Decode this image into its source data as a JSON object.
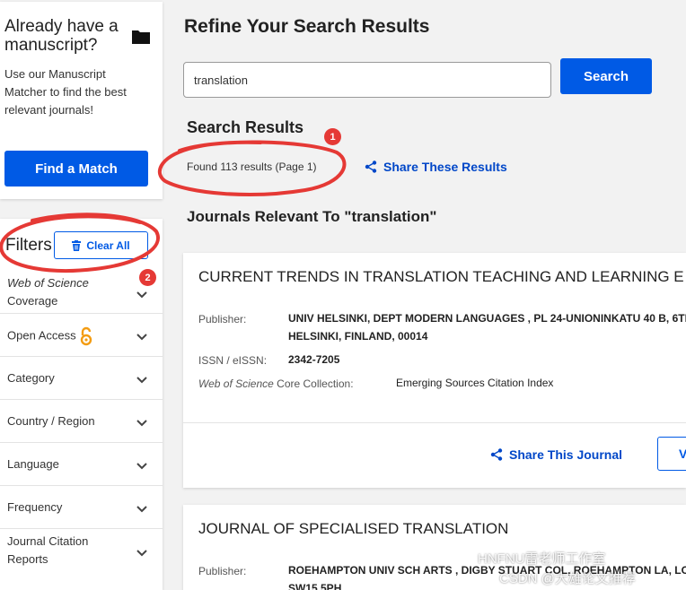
{
  "promo": {
    "title": "Already have a manuscript?",
    "text": "Use our Manuscript Matcher to find the best relevant journals!",
    "button": "Find a Match",
    "icon": "folder-icon"
  },
  "filters": {
    "label": "Filters",
    "clear_all": "Clear All",
    "badge": "2",
    "items": [
      {
        "prefix_italic": "Web of Science",
        "label": "Coverage"
      },
      {
        "label": "Open Access",
        "icon": "open-access-icon"
      },
      {
        "label": "Category"
      },
      {
        "label": "Country / Region"
      },
      {
        "label": "Language"
      },
      {
        "label": "Frequency"
      },
      {
        "label": "Journal Citation Reports"
      }
    ]
  },
  "main": {
    "title": "Refine Your Search Results",
    "search_value": "translation",
    "search_button": "Search",
    "results_heading": "Search Results",
    "results_count": "Found 113 results (Page 1)",
    "results_badge": "1",
    "share_results": "Share These Results",
    "relevant_heading": "Journals Relevant To \"translation\""
  },
  "journals": [
    {
      "title": "CURRENT TRENDS IN TRANSLATION TEACHING AND LEARNING E",
      "publisher_label": "Publisher:",
      "publisher_line1": "UNIV HELSINKI, DEPT MODERN LANGUAGES , PL 24-UNIONINKATU 40 B, 6TH",
      "publisher_line2": "HELSINKI, FINLAND, 00014",
      "issn_label": "ISSN / eISSN:",
      "issn": "2342-7205",
      "collection_label_italic": "Web of Science",
      "collection_label_rest": " Core Collection:",
      "collection": "Emerging Sources Citation Index",
      "share": "Share This Journal",
      "view": "V"
    },
    {
      "title": "JOURNAL OF SPECIALISED TRANSLATION",
      "publisher_label": "Publisher:",
      "publisher_line1": "ROEHAMPTON UNIV SCH ARTS , DIGBY STUART COL, ROEHAMPTON LA, LO",
      "publisher_line2": "SW15 5PH"
    }
  ],
  "watermark": {
    "line1": "HNFNU雷老师工作室",
    "line2": "CSDN @大雄论文推荐"
  },
  "colors": {
    "accent": "#005ae5",
    "link": "#0047c8",
    "annotation": "#e53935",
    "open_access": "#f39c12"
  }
}
